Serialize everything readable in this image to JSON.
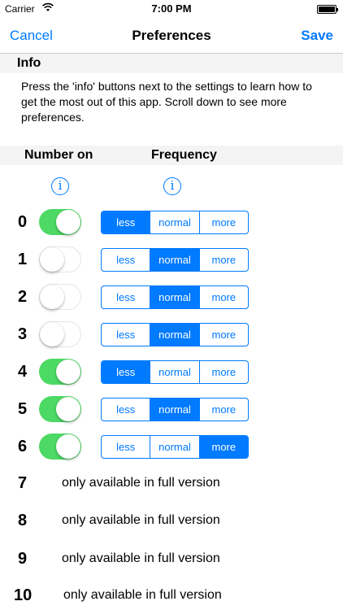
{
  "status_bar": {
    "carrier": "Carrier",
    "time": "7:00 PM"
  },
  "nav": {
    "cancel": "Cancel",
    "title": "Preferences",
    "save": "Save"
  },
  "info": {
    "header": "Info",
    "text": "Press the 'info' buttons next to the settings to learn how to get the most out of this app. Scroll down to see more preferences."
  },
  "columns": {
    "number_on": "Number on",
    "frequency": "Frequency",
    "info_glyph": "i"
  },
  "segment_labels": [
    "less",
    "normal",
    "more"
  ],
  "rows": [
    {
      "number": "0",
      "on": true,
      "selected": "less"
    },
    {
      "number": "1",
      "on": false,
      "selected": "normal"
    },
    {
      "number": "2",
      "on": false,
      "selected": "normal"
    },
    {
      "number": "3",
      "on": false,
      "selected": "normal"
    },
    {
      "number": "4",
      "on": true,
      "selected": "less"
    },
    {
      "number": "5",
      "on": true,
      "selected": "normal"
    },
    {
      "number": "6",
      "on": true,
      "selected": "more"
    }
  ],
  "locked_rows": [
    {
      "number": "7",
      "message": "only available in full version"
    },
    {
      "number": "8",
      "message": "only available in full version"
    },
    {
      "number": "9",
      "message": "only available in full version"
    },
    {
      "number": "10",
      "message": "only available in full version"
    }
  ],
  "colors": {
    "accent": "#007aff",
    "toggle_on": "#4cd964"
  }
}
